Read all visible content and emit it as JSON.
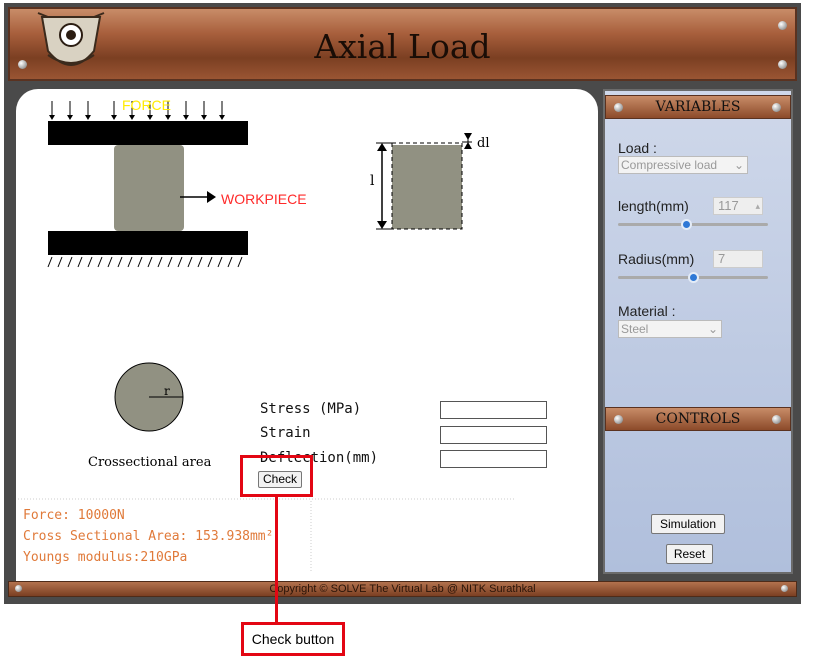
{
  "app": {
    "title": "Axial Load",
    "copyright": "Copyright © SOLVE The Virtual Lab @ NITK Surathkal"
  },
  "diagram": {
    "force_label": "FORCE",
    "workpiece_label": "WORKPIECE",
    "dl_label": "dl",
    "l_label": "l",
    "r_label": "r",
    "crossection_label": "Crossectional area"
  },
  "results": {
    "stress_label": "Stress (MPa)",
    "strain_label": "Strain",
    "deflection_label": "Deflection(mm)",
    "stress_value": "",
    "strain_value": "",
    "deflection_value": "",
    "check_label": "Check"
  },
  "info": {
    "force": "Force: 10000N",
    "area": "Cross Sectional Area: 153.938mm²",
    "modulus": "Youngs modulus:210GPa"
  },
  "variables": {
    "header": "VARIABLES",
    "load_label": "Load :",
    "load_value": "Compressive load",
    "length_label": "length(mm)",
    "length_value": "117",
    "length_fraction": 0.45,
    "radius_label": "Radius(mm)",
    "radius_value": "7",
    "radius_fraction": 0.5,
    "material_label": "Material :",
    "material_value": "Steel"
  },
  "controls": {
    "header": "CONTROLS",
    "simulation_label": "Simulation",
    "reset_label": "Reset"
  },
  "annotation": {
    "label": "Check button",
    "color": "#e30613"
  }
}
